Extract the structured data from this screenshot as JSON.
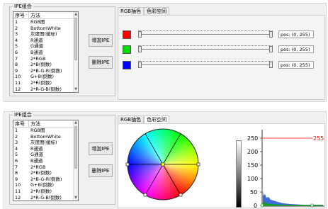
{
  "group_title": "IPE组合",
  "list": {
    "headers": [
      "序号",
      "方法"
    ],
    "rows_top": [
      [
        "1",
        "RGB图"
      ],
      [
        "2",
        "BottomWhite"
      ],
      [
        "3",
        "灰度图(缓标)"
      ],
      [
        "4",
        "R通道"
      ],
      [
        "5",
        "G通道"
      ],
      [
        "6",
        "B通道"
      ],
      [
        "7",
        "2*RGB"
      ],
      [
        "8",
        "2*B(倒数)"
      ],
      [
        "9",
        "2*B-G-R(倒数)"
      ],
      [
        "10",
        "G+B(倒数)"
      ],
      [
        "11",
        "2*R(倒数)"
      ],
      [
        "12",
        "2*R-G-B(倒数)"
      ],
      [
        "13",
        "R通道"
      ]
    ],
    "rows_bottom": [
      [
        "1",
        "RGB图"
      ],
      [
        "2",
        "BottomWhite"
      ],
      [
        "3",
        "灰度图(缓标)"
      ],
      [
        "4",
        "R通道"
      ],
      [
        "5",
        "G通道"
      ],
      [
        "6",
        "B通道"
      ],
      [
        "7",
        "2*RGB"
      ],
      [
        "8",
        "2*B(倒数)"
      ],
      [
        "9",
        "2*B-G-R(倒数)"
      ],
      [
        "10",
        "G+B(倒数)"
      ],
      [
        "11",
        "2*R(倒数)"
      ],
      [
        "12",
        "2*R-G-B(倒数)"
      ],
      [
        "13",
        "R通道"
      ]
    ]
  },
  "buttons": {
    "add": "增加IPE",
    "delete": "删除IPE"
  },
  "tabs": {
    "rgb": "RGB抽色",
    "color_space": "色彩空间"
  },
  "sliders": [
    {
      "color": "#ff0000",
      "name": "red",
      "pos_text": "pos: (0, 255)",
      "low": 0,
      "high": 255
    },
    {
      "color": "#00d800",
      "name": "green",
      "pos_text": "pos: (0, 255)",
      "low": 0,
      "high": 255
    },
    {
      "color": "#0000ff",
      "name": "blue",
      "pos_text": "pos: (0, 255)",
      "low": 0,
      "high": 255
    }
  ],
  "histogram": {
    "y_ticks": [
      "250",
      "200",
      "150",
      "100",
      "50",
      "0"
    ],
    "threshold_label": "255",
    "threshold_color": "#ff0000"
  },
  "colors": {
    "red": "#ff0000",
    "green": "#00c000",
    "blue": "#0000ff"
  }
}
